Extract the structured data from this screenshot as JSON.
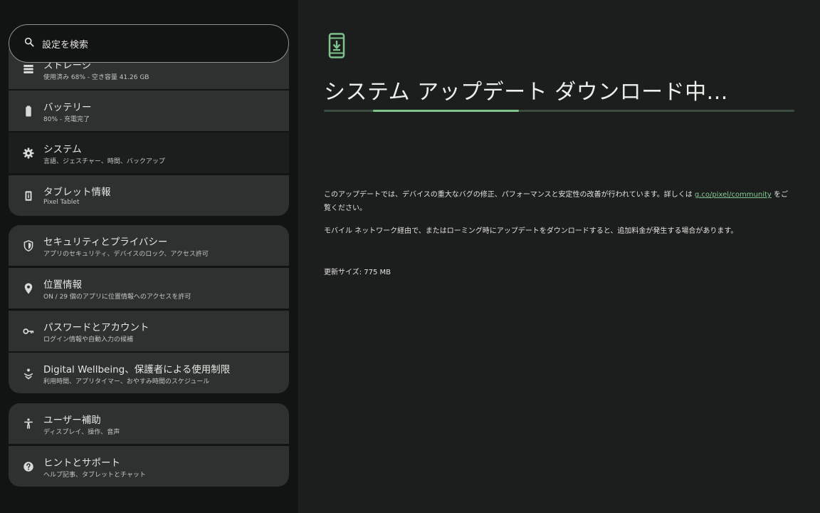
{
  "search": {
    "placeholder": "設定を検索",
    "icon": "search-icon"
  },
  "settings": {
    "storage": {
      "title": "ストレージ",
      "subtitle": "使用済み 68% - 空き容量 41.26 GB",
      "icon": "storage-icon"
    },
    "battery": {
      "title": "バッテリー",
      "subtitle": "80% - 充電完了",
      "icon": "battery-icon"
    },
    "system": {
      "title": "システム",
      "subtitle": "言語、ジェスチャー、時間、バックアップ",
      "icon": "gear-icon",
      "selected": true
    },
    "tablet_info": {
      "title": "タブレット情報",
      "subtitle": "Pixel Tablet",
      "icon": "tablet-icon"
    },
    "security": {
      "title": "セキュリティとプライバシー",
      "subtitle": "アプリのセキュリティ、デバイスのロック、アクセス許可",
      "icon": "shield-icon"
    },
    "location": {
      "title": "位置情報",
      "subtitle": "ON / 29 個のアプリに位置情報へのアクセスを許可",
      "icon": "location-pin-icon"
    },
    "passwords": {
      "title": "パスワードとアカウント",
      "subtitle": "ログイン情報や自動入力の候補",
      "icon": "key-icon"
    },
    "wellbeing": {
      "title": "Digital Wellbeing、保護者による使用制限",
      "subtitle": "利用時間、アプリタイマー、おやすみ時間のスケジュール",
      "icon": "wellbeing-icon"
    },
    "accessibility": {
      "title": "ユーザー補助",
      "subtitle": "ディスプレイ、操作、音声",
      "icon": "accessibility-icon"
    },
    "help": {
      "title": "ヒントとサポート",
      "subtitle": "ヘルプ記事、タブレットとチャット",
      "icon": "help-icon"
    }
  },
  "update": {
    "icon": "system-update-icon",
    "title": "システム アップデート ダウンロード中...",
    "progress": 0.31,
    "description_before": "このアップデートでは、デバイスの重大なバグの修正、パフォーマンスと安定性の改善が行われています。詳しくは ",
    "link": "g.co/pixel/community",
    "description_after": " をご覧ください。",
    "mobile_warning": "モバイル ネットワーク経由で、またはローミング時にアップデートをダウンロードすると、追加料金が発生する場合があります。",
    "size_text": "更新サイズ: 775 MB"
  },
  "colors": {
    "accent": "#7fc38c",
    "link": "#86c995",
    "item_bg": "#2e312f",
    "selected_bg": "#1c1e1d"
  }
}
